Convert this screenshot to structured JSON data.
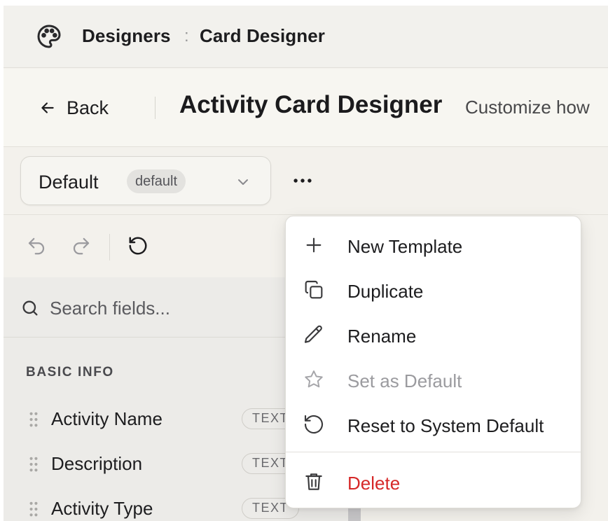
{
  "breadcrumb": {
    "first": "Designers",
    "separator": ":",
    "second": "Card Designer"
  },
  "header": {
    "back_label": "Back",
    "title": "Activity Card Designer",
    "subtitle": "Customize how"
  },
  "template_select": {
    "value": "Default",
    "badge": "default"
  },
  "search": {
    "placeholder": "Search fields..."
  },
  "field_section": {
    "title": "BASIC INFO",
    "fields": [
      {
        "name": "Activity Name",
        "type": "TEXT"
      },
      {
        "name": "Description",
        "type": "TEXT"
      },
      {
        "name": "Activity Type",
        "type": "TEXT"
      }
    ]
  },
  "menu": {
    "items": [
      {
        "label": "New Template",
        "icon": "plus-icon",
        "state": "normal"
      },
      {
        "label": "Duplicate",
        "icon": "copy-icon",
        "state": "normal"
      },
      {
        "label": "Rename",
        "icon": "pencil-icon",
        "state": "normal"
      },
      {
        "label": "Set as Default",
        "icon": "star-icon",
        "state": "disabled"
      },
      {
        "label": "Reset to System Default",
        "icon": "reset-icon",
        "state": "normal"
      },
      {
        "label": "Delete",
        "icon": "trash-icon",
        "state": "danger"
      }
    ]
  },
  "colors": {
    "danger": "#d62828",
    "disabled": "#9b9b9f",
    "text": "#1d1d1f"
  }
}
